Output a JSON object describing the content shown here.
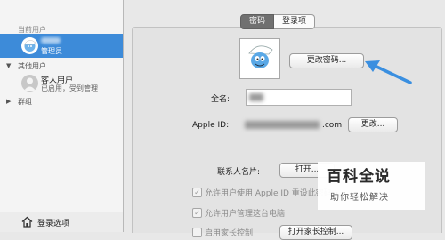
{
  "sidebar": {
    "current_user_label": "当前用户",
    "current_user_role": "管理员",
    "other_users_label": "其他用户",
    "guest": {
      "name": "客人用户",
      "status": "已启用，受到管理"
    },
    "groups_label": "群组",
    "login_options_label": "登录选项"
  },
  "tabs": [
    {
      "label": "密码",
      "active": true
    },
    {
      "label": "登录项",
      "active": false
    }
  ],
  "change_password_button": "更改密码...",
  "full_name_label": "全名:",
  "apple_id_label": "Apple ID:",
  "apple_id_domain": ".com",
  "change_button": "更改...",
  "contact_card_label": "联系人名片:",
  "open_button": "打开...",
  "checkboxes": [
    {
      "label": "允许用户使用 Apple ID 重设此密码",
      "checked": true
    },
    {
      "label": "允许用户管理这台电脑",
      "checked": true
    },
    {
      "label": "启用家长控制",
      "checked": false
    }
  ],
  "parental_controls_button": "打开家长控制...",
  "watermark": {
    "title": "百科全说",
    "subtitle": "助你轻松解决"
  },
  "colors": {
    "selection": "#3d8bd9",
    "arrow": "#3a8fe0",
    "tab_active": "#707070"
  }
}
